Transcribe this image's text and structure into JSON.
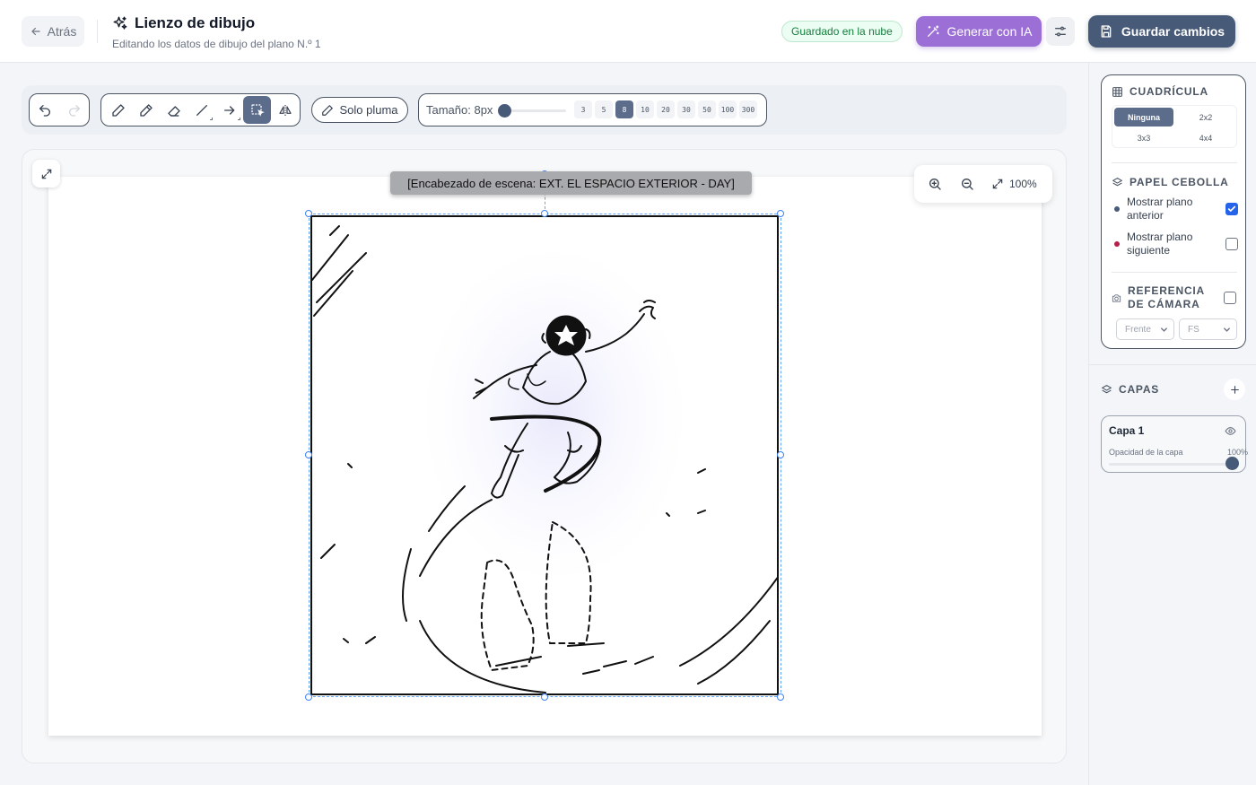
{
  "header": {
    "back_label": "Atrás",
    "title": "Lienzo de dibujo",
    "subtitle": "Editando los datos de dibujo del plano N.º 1",
    "cloud_status": "Guardado en la nube",
    "ai_label": "Generar con IA",
    "save_label": "Guardar cambios",
    "ai_color": "#9b6fd6",
    "save_color": "#475a78"
  },
  "toolbar": {
    "pen_only_label": "Solo pluma",
    "size_label": "Tamaño: 8px",
    "sizes": [
      "3",
      "5",
      "8",
      "10",
      "20",
      "30",
      "50",
      "100",
      "300"
    ],
    "active_size": "8",
    "active_tool": "lasso-select"
  },
  "canvas": {
    "scene_heading": "[Encabezado de escena: EXT. EL ESPACIO EXTERIOR - DAY]",
    "zoom_level": "100%"
  },
  "sidebar": {
    "grid": {
      "title": "CUADRÍCULA",
      "options": [
        "Ninguna",
        "2x2",
        "3x3",
        "4x4"
      ],
      "active": "Ninguna"
    },
    "onion": {
      "title": "PAPEL CEBOLLA",
      "prev_label": "Mostrar plano anterior",
      "prev_checked": true,
      "prev_color": "#475a78",
      "next_label": "Mostrar plano siguiente",
      "next_checked": false,
      "next_color": "#b3214a"
    },
    "camera": {
      "title": "REFERENCIA DE CÁMARA",
      "checked": false,
      "angle_value": "Frente",
      "shot_value": "FS"
    },
    "layers": {
      "title": "CAPAS",
      "items": [
        {
          "name": "Capa 1",
          "opacity_label": "Opacidad de la capa",
          "opacity_value": "100%",
          "opacity": 1.0
        }
      ]
    }
  }
}
